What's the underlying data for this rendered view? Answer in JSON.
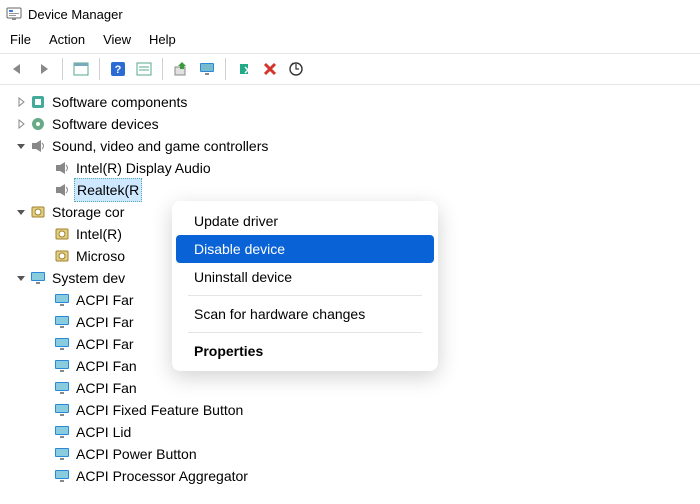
{
  "window": {
    "title": "Device Manager"
  },
  "menubar": [
    "File",
    "Action",
    "View",
    "Help"
  ],
  "toolbar_icons": [
    "back",
    "forward",
    "properties-pane",
    "help",
    "properties",
    "show-hidden",
    "update",
    "monitor",
    "enable",
    "disable",
    "scan"
  ],
  "tree": [
    {
      "label": "Software components",
      "icon": "component",
      "expanded": false,
      "children": []
    },
    {
      "label": "Software devices",
      "icon": "software-device",
      "expanded": false,
      "children": []
    },
    {
      "label": "Sound, video and game controllers",
      "icon": "speaker",
      "expanded": true,
      "children": [
        {
          "label": "Intel(R) Display Audio",
          "icon": "speaker"
        },
        {
          "label": "Realtek(R) Audio",
          "icon": "speaker",
          "selected": true,
          "truncated_label": "Realtek(R"
        }
      ]
    },
    {
      "label": "Storage controllers",
      "icon": "storage",
      "expanded": true,
      "truncated_label": "Storage cor",
      "children": [
        {
          "label": "Intel(R) ...",
          "icon": "storage",
          "truncated_label": "Intel(R)"
        },
        {
          "label": "Microsoft ...",
          "icon": "storage",
          "truncated_label": "Microso"
        }
      ]
    },
    {
      "label": "System devices",
      "icon": "system",
      "expanded": true,
      "truncated_label": "System dev",
      "children": [
        {
          "label": "ACPI Fan",
          "icon": "system",
          "truncated_label": "ACPI Far"
        },
        {
          "label": "ACPI Fan",
          "icon": "system",
          "truncated_label": "ACPI Far"
        },
        {
          "label": "ACPI Fan",
          "icon": "system",
          "truncated_label": "ACPI Far"
        },
        {
          "label": "ACPI Fan",
          "icon": "system"
        },
        {
          "label": "ACPI Fan",
          "icon": "system"
        },
        {
          "label": "ACPI Fixed Feature Button",
          "icon": "system"
        },
        {
          "label": "ACPI Lid",
          "icon": "system"
        },
        {
          "label": "ACPI Power Button",
          "icon": "system"
        },
        {
          "label": "ACPI Processor Aggregator",
          "icon": "system"
        }
      ]
    }
  ],
  "context_menu": {
    "items": [
      {
        "label": "Update driver",
        "type": "item"
      },
      {
        "label": "Disable device",
        "type": "item",
        "highlight": true
      },
      {
        "label": "Uninstall device",
        "type": "item"
      },
      {
        "type": "sep"
      },
      {
        "label": "Scan for hardware changes",
        "type": "item"
      },
      {
        "type": "sep"
      },
      {
        "label": "Properties",
        "type": "item",
        "bold": true
      }
    ]
  }
}
